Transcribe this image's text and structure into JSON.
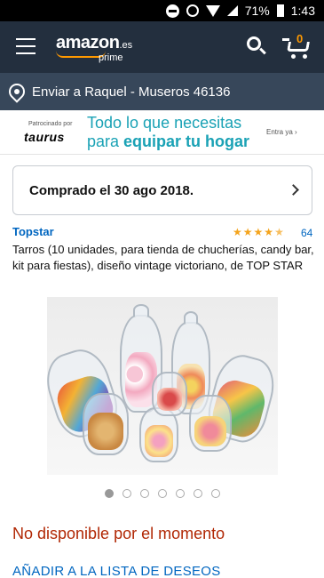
{
  "status_bar": {
    "battery": "71%",
    "time": "1:43"
  },
  "header": {
    "logo_text": "amazon",
    "logo_domain": ".es",
    "logo_sub": "prime",
    "cart_count": "0",
    "icons": [
      "menu-icon",
      "search-icon",
      "cart-icon"
    ]
  },
  "location": {
    "text": "Enviar a Raquel - Museros 46136",
    "icon": "location-pin-icon"
  },
  "ad": {
    "sponsored": "Patrocinado por",
    "brand": "taurus",
    "line1": "Todo lo que necesitas",
    "line2_prefix": "para",
    "line2_bold": "equipar tu hogar",
    "cta": "Entra ya ›"
  },
  "purchase_notice": {
    "text": "Comprado el 30 ago 2018."
  },
  "product": {
    "brand": "Topstar",
    "rating": 4.5,
    "review_count": "64",
    "title": "Tarros (10 unidades, para tienda de chucherías, candy bar, kit para fiestas), diseño vintage victoriano, de TOP STAR",
    "image_count": 7,
    "active_image": 1
  },
  "availability": "No disponible por el momento",
  "wishlist": "AÑADIR A LA LISTA DE DESEOS",
  "colors": {
    "header_bg": "#232f3e",
    "location_bg": "#37475a",
    "link": "#0066c0",
    "unavailable": "#b12704",
    "star": "#f4a41d",
    "ad_text": "#1aa2b5"
  }
}
